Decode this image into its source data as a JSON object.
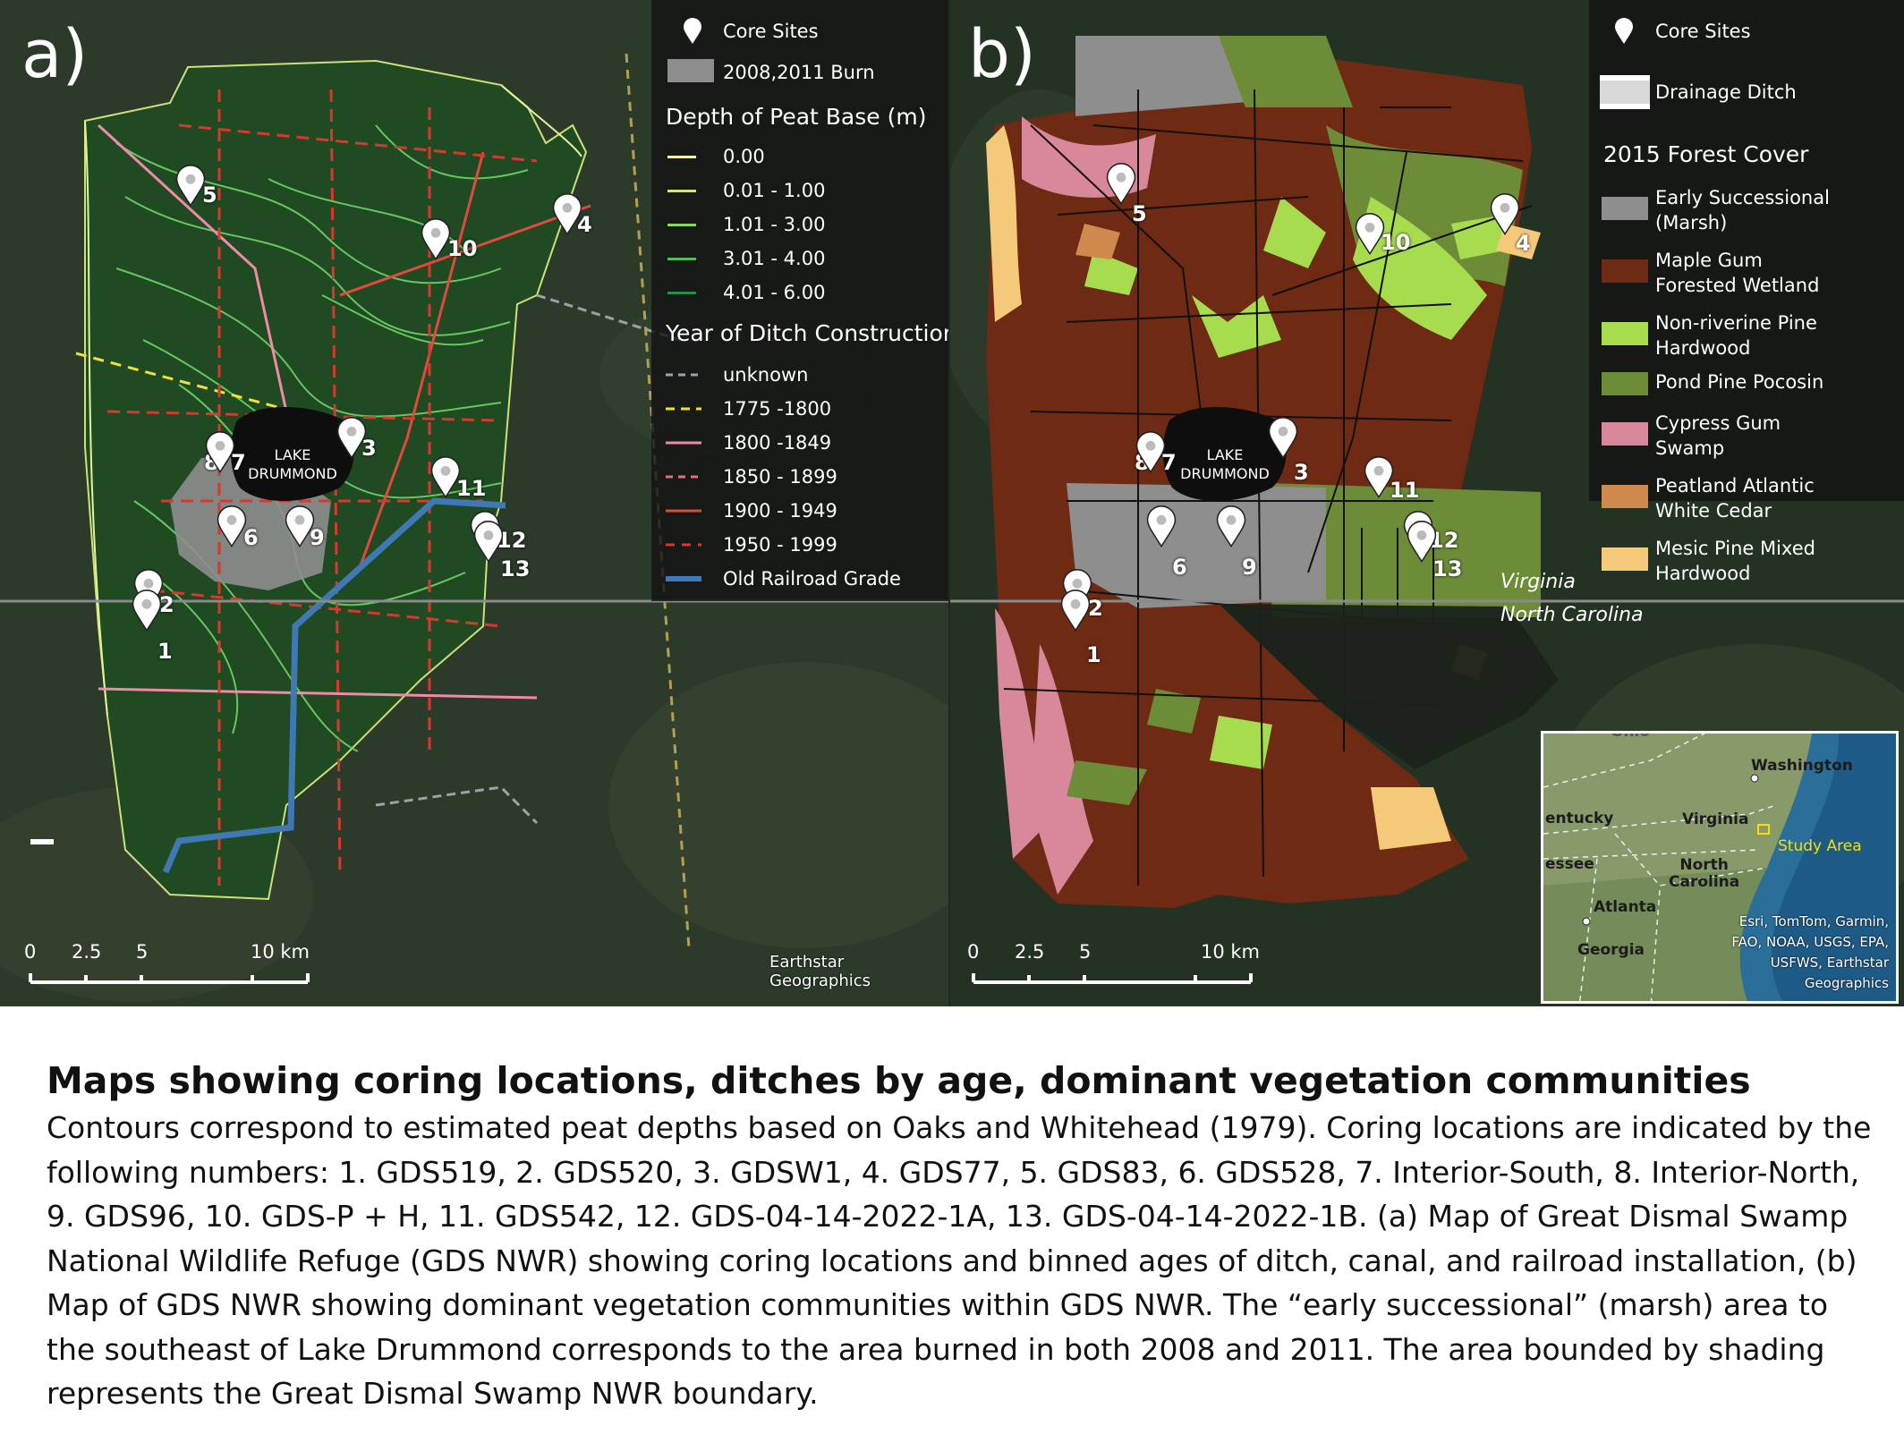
{
  "panel_a": {
    "label": "a)",
    "lake": {
      "line1": "LAKE",
      "line2": "DRUMMOND"
    },
    "legend": {
      "core_sites": "Core Sites",
      "burn": "2008,2011 Burn",
      "depth_title": "Depth of Peat Base (m)",
      "depth_items": [
        "0.00",
        "0.01 - 1.00",
        "1.01 - 3.00",
        "3.01 - 4.00",
        "4.01 - 6.00"
      ],
      "ditch_title": "Year of Ditch Construction",
      "ditch_items": [
        "unknown",
        "1775 -1800",
        "1800 -1849",
        "1850 - 1899",
        "1900 - 1949",
        "1950 - 1999",
        "Old Railroad Grade"
      ]
    },
    "sites": [
      "5",
      "4",
      "10",
      "8",
      "7",
      "3",
      "11",
      "6",
      "9",
      "12",
      "13",
      "2",
      "1"
    ],
    "scale": [
      "0",
      "2.5",
      "5",
      "10 km"
    ],
    "attribution": "Earthstar Geographics"
  },
  "panel_b": {
    "label": "b)",
    "lake": {
      "line1": "LAKE",
      "line2": "DRUMMOND"
    },
    "legend": {
      "core_sites": "Core Sites",
      "ditch": "Drainage Ditch",
      "cover_title": "2015 Forest Cover",
      "cover_items": [
        {
          "l1": "Early Successional",
          "l2": "(Marsh)"
        },
        {
          "l1": "Maple Gum",
          "l2": "Forested Wetland"
        },
        {
          "l1": "Non-riverine Pine",
          "l2": "Hardwood"
        },
        {
          "l1": "Pond Pine Pocosin",
          "l2": ""
        },
        {
          "l1": "Cypress Gum",
          "l2": "Swamp"
        },
        {
          "l1": "Peatland Atlantic",
          "l2": "White Cedar"
        },
        {
          "l1": "Mesic Pine Mixed",
          "l2": "Hardwood"
        }
      ]
    },
    "sites": [
      "5",
      "10",
      "4",
      "8",
      "7",
      "3",
      "11",
      "6",
      "9",
      "12",
      "13",
      "2",
      "1"
    ],
    "states": {
      "north": "Virginia",
      "south": "North Carolina"
    },
    "scale": [
      "0",
      "2.5",
      "5",
      "10 km"
    ],
    "inset": {
      "ohio": "Ohio",
      "washington": "Washington",
      "kentucky": "entucky",
      "virginia": "Virginia",
      "study_area": "Study Area",
      "tennessee": "essee",
      "north_carolina": "North\nCarolina",
      "atlanta": "Atlanta",
      "georgia": "Georgia",
      "attribution": "Esri, TomTom, Garmin, FAO, NOAA, USGS, EPA, USFWS, Earthstar Geographics"
    }
  },
  "colors": {
    "depth": [
      "#f6f2a8",
      "#cfe87a",
      "#8fd46a",
      "#4cbf5a",
      "#2a8c44"
    ],
    "ditch": [
      "#9aa3a8",
      "#f0e03c",
      "#f08aa8",
      "#f06a80",
      "#e2483e",
      "#d8382e",
      "#3f78b4"
    ],
    "cover": [
      "#8e8e8e",
      "#6e2a12",
      "#a6dc4e",
      "#6c8c38",
      "#d9879a",
      "#d08a4e",
      "#f5c97a"
    ]
  },
  "caption": {
    "title": "Maps showing coring locations, ditches by age, dominant vegetation communities",
    "body": "Contours correspond to estimated peat depths based on Oaks and Whitehead (1979). Coring locations are indicated by the following numbers: 1. GDS519, 2. GDS520, 3. GDSW1, 4. GDS77, 5. GDS83, 6. GDS528, 7. Interior-South, 8. Interior-North, 9. GDS96, 10. GDS-P + H, 11. GDS542, 12. GDS-04-14-2022-1A, 13. GDS-04-14-2022-1B. (a) Map of Great Dismal Swamp National Wildlife Refuge (GDS NWR) showing coring locations and binned ages of ditch, canal, and railroad installation, (b) Map of GDS NWR showing dominant vegetation communities within GDS NWR. The “early successional” (marsh) area to the southeast of Lake Drummond corresponds to the area burned in both 2008 and 2011. The area bounded by shading represents the Great Dismal Swamp NWR boundary."
  }
}
